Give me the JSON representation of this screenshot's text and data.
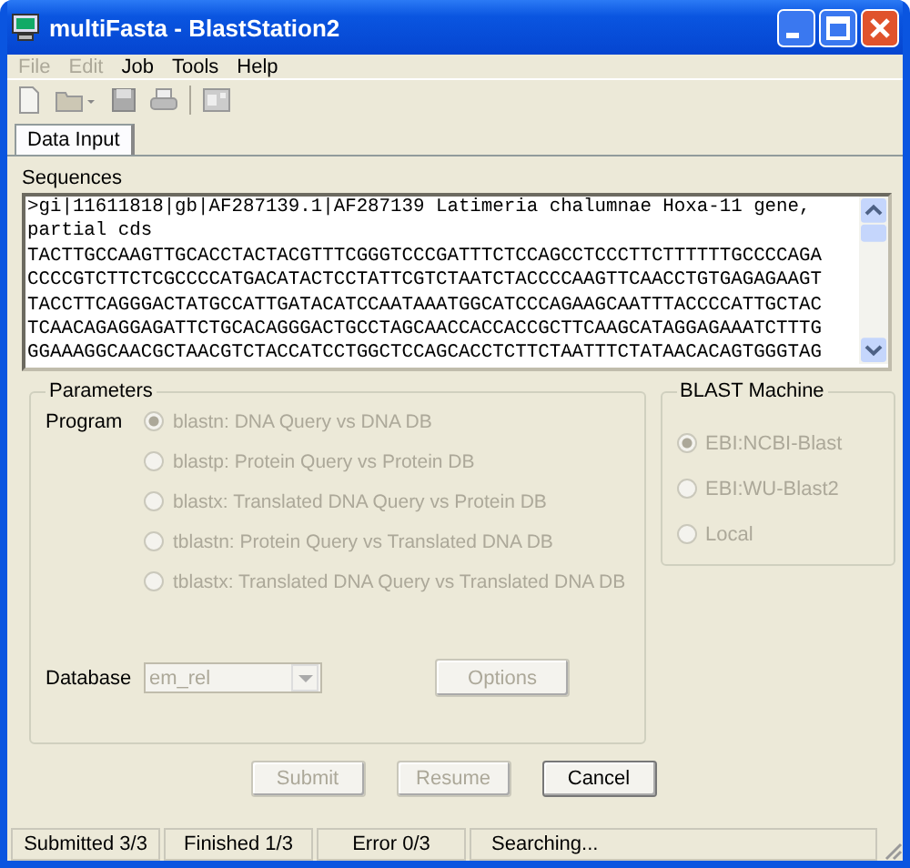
{
  "window": {
    "title": "multiFasta - BlastStation2"
  },
  "menu": [
    {
      "label": "File",
      "disabled": true
    },
    {
      "label": "Edit",
      "disabled": true
    },
    {
      "label": "Job",
      "disabled": false
    },
    {
      "label": "Tools",
      "disabled": false
    },
    {
      "label": "Help",
      "disabled": false
    }
  ],
  "tabs": [
    {
      "label": "Data Input",
      "selected": true
    }
  ],
  "sequences": {
    "label": "Sequences",
    "value": ">gi|11611818|gb|AF287139.1|AF287139 Latimeria chalumnae Hoxa-11 gene, partial cds\nTACTTGCCAAGTTGCACCTACTACGTTTCGGGTCCCGATTTCTCCAGCCTCCCTTCTTTTTTGCCCCAGA\nCCCCGTCTTCTCGCCCCATGACATACTCCTATTCGTCTAATCTACCCCAAGTTCAACCTGTGAGAGAAGT\nTACCTTCAGGGACTATGCCATTGATACATCCAATAAATGGCATCCCAGAAGCAATTTACCCCATTGCTAC\nTCAACAGAGGAGATTCTGCACAGGGACTGCCTAGCAACCACCACCGCTTCAAGCATAGGAGAAATCTTTG\nGGAAAGGCAACGCTAACGTCTACCATCCTGGCTCCAGCACCTCTTCTAATTTCTATAACACAGTGGGTAG"
  },
  "parameters": {
    "title": "Parameters",
    "program_label": "Program",
    "programs": [
      {
        "label": "blastn: DNA Query vs DNA DB",
        "selected": true,
        "disabled": true
      },
      {
        "label": "blastp: Protein Query vs Protein DB",
        "selected": false,
        "disabled": true
      },
      {
        "label": "blastx: Translated DNA Query vs Protein DB",
        "selected": false,
        "disabled": true
      },
      {
        "label": "tblastn: Protein Query vs Translated DNA DB",
        "selected": false,
        "disabled": true
      },
      {
        "label": "tblastx: Translated DNA Query vs Translated DNA DB",
        "selected": false,
        "disabled": true
      }
    ],
    "database_label": "Database",
    "database": {
      "value": "em_rel",
      "disabled": true
    },
    "options_button": {
      "label": "Options",
      "disabled": true
    }
  },
  "blast_machine": {
    "title": "BLAST Machine",
    "options": [
      {
        "label": "EBI:NCBI-Blast",
        "selected": true,
        "disabled": true
      },
      {
        "label": "EBI:WU-Blast2",
        "selected": false,
        "disabled": true
      },
      {
        "label": "Local",
        "selected": false,
        "disabled": true
      }
    ]
  },
  "buttons": [
    {
      "label": "Submit",
      "disabled": true
    },
    {
      "label": "Resume",
      "disabled": true
    },
    {
      "label": "Cancel",
      "disabled": false
    }
  ],
  "status_bar": [
    "Submitted 3/3",
    "Finished 1/3",
    "Error 0/3",
    "Searching..."
  ]
}
